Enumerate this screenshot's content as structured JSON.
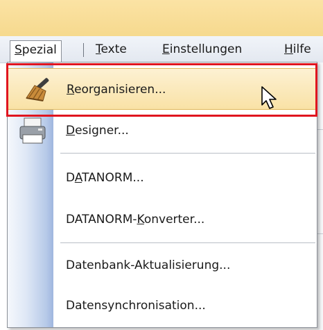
{
  "menubar": {
    "items": [
      {
        "prefix": "",
        "key": "S",
        "rest": "pezial"
      },
      {
        "prefix": "",
        "key": "T",
        "rest": "exte"
      },
      {
        "prefix": "",
        "key": "E",
        "rest": "instellungen"
      },
      {
        "prefix": "",
        "key": "H",
        "rest": "ilfe"
      }
    ]
  },
  "dropdown": {
    "items": [
      {
        "prefix": "",
        "key": "R",
        "rest": "eorganisieren...",
        "icon": "broom-icon",
        "highlighted": true
      },
      {
        "prefix": "",
        "key": "D",
        "rest": "esigner...",
        "icon": "printer-icon"
      },
      {
        "prefix": "D",
        "key": "A",
        "rest": "TANORM..."
      },
      {
        "prefix": "DATANORM-",
        "key": "K",
        "rest": "onverter..."
      },
      {
        "prefix": "Datenbank-Aktualisierung...",
        "key": "",
        "rest": ""
      },
      {
        "prefix": "Datensynchronisation...",
        "key": "",
        "rest": ""
      }
    ]
  },
  "colors": {
    "highlight_border": "#e0151f",
    "hover_fill": "#f9e2a6",
    "titlebar": "#f6d98e"
  }
}
